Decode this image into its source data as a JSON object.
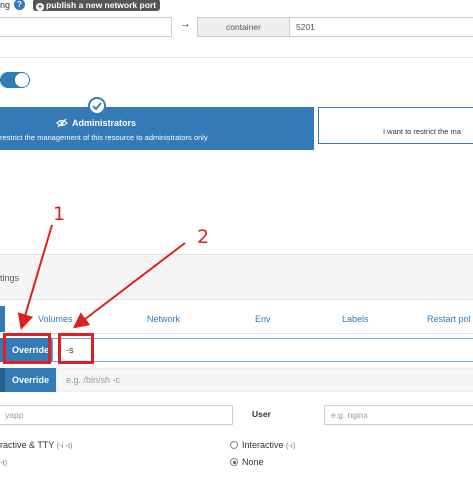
{
  "port_mapping": {
    "label_fragment": "ng",
    "help_glyph": "?",
    "publish_button_label": "publish a new network port",
    "host_value": "",
    "arrow_glyph": "→",
    "container_addon": "container",
    "container_value": "5201"
  },
  "access_control": {
    "admin_title": "Administrators",
    "admin_description": "restrict the management of this resource to administrators only",
    "other_description": "I want to restrict the ma"
  },
  "advanced": {
    "section_title_fragment": "tings",
    "tabs": [
      {
        "label": "Volumes"
      },
      {
        "label": "Network"
      },
      {
        "label": "Env"
      },
      {
        "label": "Labels"
      },
      {
        "label": "Restart pol"
      }
    ]
  },
  "command": {
    "override_label": "Override",
    "command_value": "-s",
    "entrypoint_override_label": "Override",
    "entrypoint_placeholder": "e.g. /bin/sh -c",
    "workdir_value_fragment": "yapp",
    "user_label": "User",
    "user_placeholder": "e.g. nginx",
    "console_option_1": "ractive & TTY",
    "console_option_1_flag": "(-i -t)",
    "console_option_2": "Interactive",
    "console_option_2_flag": "(-i)",
    "console_option_3_flag": "-t)",
    "console_option_4": "None"
  },
  "annotations": {
    "marker_1": "1",
    "marker_2": "2"
  },
  "colors": {
    "primary": "#337ab7",
    "annotation_red": "#e02020"
  }
}
